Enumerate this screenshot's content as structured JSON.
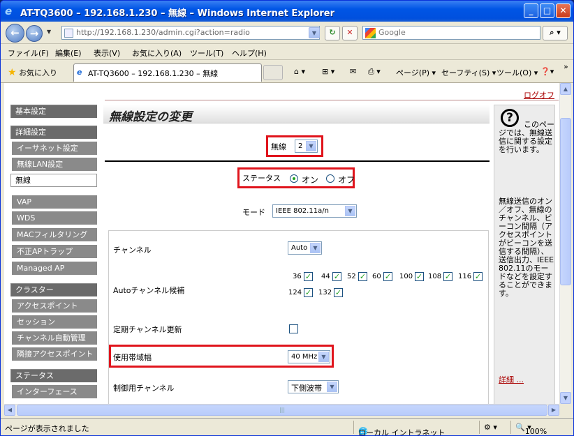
{
  "window": {
    "title": "AT-TQ3600 – 192.168.1.230 – 無線 – Windows Internet Explorer"
  },
  "address_bar": {
    "url": "http://192.168.1.230/admin.cgi?action=radio",
    "search_placeholder": "Google"
  },
  "menu": [
    "ファイル(F)",
    "編集(E)",
    "表示(V)",
    "お気に入り(A)",
    "ツール(T)",
    "ヘルプ(H)"
  ],
  "favorites_bar": {
    "favorites_label": "お気に入り",
    "tab_title": "AT-TQ3600 – 192.168.1.230 – 無線",
    "page_menu": "ページ(P)",
    "safety_menu": "セーフティ(S)",
    "tools_menu": "ツール(O)"
  },
  "page": {
    "logout": "ログオフ",
    "heading": "無線設定の変更",
    "sidebar": [
      {
        "label": "基本設定",
        "kind": "sec"
      },
      {
        "label": "詳細設定",
        "kind": "sec"
      },
      {
        "label": "イーサネット設定",
        "kind": "sub"
      },
      {
        "label": "無線LAN設定",
        "kind": "sub"
      },
      {
        "label": "無線",
        "kind": "active"
      },
      {
        "label": "VAP",
        "kind": "sub"
      },
      {
        "label": "WDS",
        "kind": "sub"
      },
      {
        "label": "MACフィルタリング",
        "kind": "sub"
      },
      {
        "label": "不正APトラップ",
        "kind": "sub"
      },
      {
        "label": "Managed AP",
        "kind": "sub"
      },
      {
        "label": "クラスター",
        "kind": "sec"
      },
      {
        "label": "アクセスポイント",
        "kind": "sub"
      },
      {
        "label": "セッション",
        "kind": "sub"
      },
      {
        "label": "チャンネル自動管理",
        "kind": "sub"
      },
      {
        "label": "隣接アクセスポイント",
        "kind": "sub"
      },
      {
        "label": "ステータス",
        "kind": "sec"
      },
      {
        "label": "インターフェース",
        "kind": "sub"
      }
    ],
    "radio_select": {
      "label": "無線",
      "value": "2"
    },
    "status": {
      "label": "ステータス",
      "on": "オン",
      "off": "オフ",
      "selected": "オン"
    },
    "mode": {
      "label": "モード",
      "value": "IEEE 802.11a/n"
    },
    "channel": {
      "label": "チャンネル",
      "value": "Auto"
    },
    "auto_channel": {
      "label": "Autoチャンネル候補",
      "channels": [
        "36",
        "44",
        "52",
        "60",
        "100",
        "108",
        "116",
        "124",
        "132"
      ]
    },
    "periodic_update": {
      "label": "定期チャンネル更新"
    },
    "bandwidth": {
      "label": "使用帯域幅",
      "value": "40 MHz"
    },
    "control_channel": {
      "label": "制御用チャンネル",
      "value": "下側波帯"
    },
    "help": {
      "text1": "このページでは、無線送信に関する設定を行います。",
      "text2": "無線送信のオン／オフ、無線のチャンネル、ビーコン間隔（アクセスポイントがビーコンを送信する間隔）、送信出力、IEEE802.11のモードなどを設定することができます。",
      "more": "詳細 ..."
    }
  },
  "statusbar": {
    "text": "ページが表示されました",
    "zone": "ローカル イントラネット",
    "zoom": "100%"
  }
}
